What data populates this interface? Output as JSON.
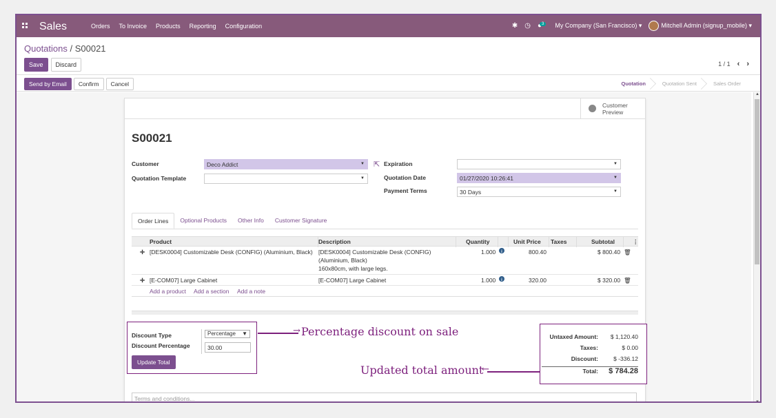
{
  "topbar": {
    "app_title": "Sales",
    "menu": [
      "Orders",
      "To Invoice",
      "Products",
      "Reporting",
      "Configuration"
    ],
    "chat_badge": "3",
    "company": "My Company (San Francisco)",
    "user": "Mitchell Admin (signup_mobile)"
  },
  "breadcrumb": {
    "parent": "Quotations",
    "separator": " / ",
    "current": "S00021"
  },
  "control": {
    "save": "Save",
    "discard": "Discard",
    "pager": "1 / 1"
  },
  "statusbar": {
    "send_email": "Send by Email",
    "confirm": "Confirm",
    "cancel": "Cancel",
    "stages": [
      "Quotation",
      "Quotation Sent",
      "Sales Order"
    ],
    "active_stage": "Quotation"
  },
  "sheet": {
    "preview_line1": "Customer",
    "preview_line2": "Preview",
    "title": "S00021",
    "customer_label": "Customer",
    "customer_value": "Deco Addict",
    "template_label": "Quotation Template",
    "template_value": "",
    "expiration_label": "Expiration",
    "expiration_value": "",
    "qdate_label": "Quotation Date",
    "qdate_value": "01/27/2020 10:26:41",
    "terms_label": "Payment Terms",
    "terms_value": "30 Days"
  },
  "tabs": [
    "Order Lines",
    "Optional Products",
    "Other Info",
    "Customer Signature"
  ],
  "table": {
    "headers": {
      "product": "Product",
      "description": "Description",
      "quantity": "Quantity",
      "unit_price": "Unit Price",
      "taxes": "Taxes",
      "subtotal": "Subtotal"
    },
    "rows": [
      {
        "product": "[DESK0004] Customizable Desk (CONFIG) (Aluminium, Black)",
        "desc1": "[DESK0004] Customizable Desk (CONFIG)",
        "desc2": "(Aluminium, Black)",
        "desc3": "160x80cm, with large legs.",
        "quantity": "1.000",
        "unit_price": "800.40",
        "subtotal": "$ 800.40"
      },
      {
        "product": "[E-COM07] Large Cabinet",
        "desc1": "[E-COM07] Large Cabinet",
        "quantity": "1.000",
        "unit_price": "320.00",
        "subtotal": "$ 320.00"
      }
    ],
    "add_product": "Add a product",
    "add_section": "Add a section",
    "add_note": "Add a note"
  },
  "discount": {
    "type_label": "Discount Type",
    "type_value": "Percentage",
    "percent_label": "Discount Percentage",
    "percent_value": "30.00",
    "update_button": "Update Total"
  },
  "totals": {
    "untaxed_label": "Untaxed Amount:",
    "untaxed_value": "$ 1,120.40",
    "taxes_label": "Taxes:",
    "taxes_value": "$ 0.00",
    "discount_label": "Discount:",
    "discount_value": "$ -336.12",
    "total_label": "Total:",
    "total_value": "$ 784.28"
  },
  "terms_placeholder": "Terms and conditions...",
  "annotations": {
    "discount_note": "Percentage discount on sale",
    "total_note": "Updated total amount"
  },
  "colors": {
    "brand": "#875A7B",
    "annotation": "#7c1f7c",
    "required_field": "#d2c6e8"
  }
}
